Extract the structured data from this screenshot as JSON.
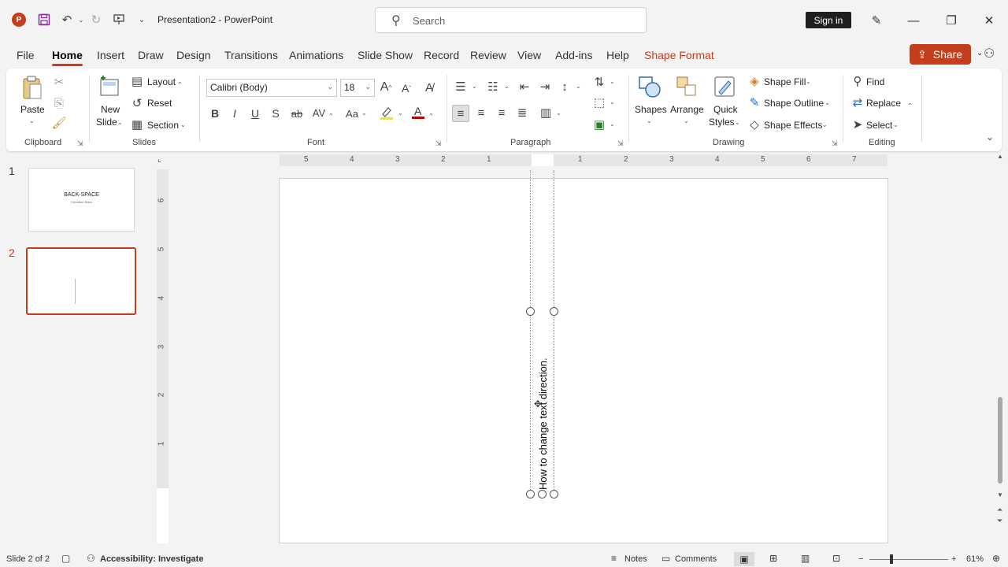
{
  "titlebar": {
    "doc_title": "Presentation2  -  PowerPoint",
    "search_placeholder": "Search",
    "signin_label": "Sign in"
  },
  "tabs": [
    {
      "label": "File"
    },
    {
      "label": "Home"
    },
    {
      "label": "Insert"
    },
    {
      "label": "Draw"
    },
    {
      "label": "Design"
    },
    {
      "label": "Transitions"
    },
    {
      "label": "Animations"
    },
    {
      "label": "Slide Show"
    },
    {
      "label": "Record"
    },
    {
      "label": "Review"
    },
    {
      "label": "View"
    },
    {
      "label": "Add-ins"
    },
    {
      "label": "Help"
    },
    {
      "label": "Shape Format"
    }
  ],
  "share_label": "Share",
  "ribbon": {
    "clipboard": {
      "paste": "Paste",
      "group": "Clipboard"
    },
    "slides": {
      "new_slide_1": "New",
      "new_slide_2": "Slide",
      "layout": "Layout",
      "reset": "Reset",
      "section": "Section",
      "group": "Slides"
    },
    "font": {
      "font_name": "Calibri (Body)",
      "font_size": "18",
      "group": "Font"
    },
    "paragraph": {
      "group": "Paragraph"
    },
    "drawing": {
      "shapes": "Shapes",
      "arrange": "Arrange",
      "quick_1": "Quick",
      "quick_2": "Styles",
      "shape_fill": "Shape Fill",
      "shape_outline": "Shape Outline",
      "shape_effects": "Shape Effects",
      "group": "Drawing"
    },
    "editing": {
      "find": "Find",
      "replace": "Replace",
      "select": "Select",
      "group": "Editing"
    }
  },
  "thumbnails": [
    {
      "num": "1",
      "title": "BACK-SPACE",
      "subtitle": "Formatted Slides"
    },
    {
      "num": "2"
    }
  ],
  "hruler_labels": [
    "5",
    "4",
    "3",
    "2",
    "1",
    "1",
    "2",
    "3",
    "4",
    "5",
    "6",
    "7"
  ],
  "vruler_labels": [
    "6",
    "5",
    "4",
    "3",
    "2",
    "1"
  ],
  "slide": {
    "text": "How to change text direction."
  },
  "statusbar": {
    "slide_info": "Slide 2 of 2",
    "accessibility": "Accessibility: Investigate",
    "notes": "Notes",
    "comments": "Comments",
    "zoom": "61%"
  },
  "colors": {
    "accent": "#c43e1c"
  }
}
